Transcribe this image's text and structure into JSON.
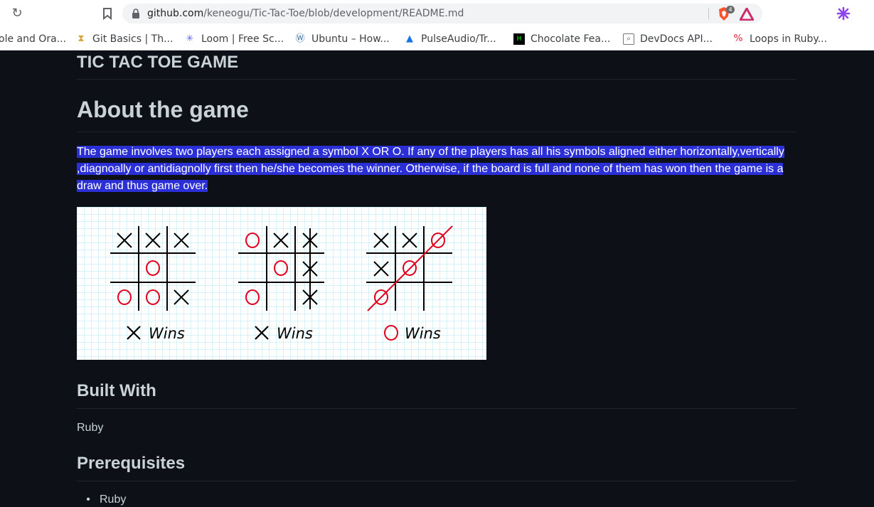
{
  "browser": {
    "url_host": "github.com",
    "url_path": "/keneogu/Tic-Tac-Toe/blob/development/README.md",
    "brave_badge": "4",
    "bookmarks": [
      {
        "label": "ole and Ora...",
        "icon": "oracle-icon"
      },
      {
        "label": "Git Basics | Th...",
        "icon": "hourglass-icon"
      },
      {
        "label": "Loom | Free Sc...",
        "icon": "loom-icon"
      },
      {
        "label": "Ubuntu – How...",
        "icon": "wordpress-icon"
      },
      {
        "label": "PulseAudio/Tr...",
        "icon": "pulseaudio-icon"
      },
      {
        "label": "Chocolate Fea...",
        "icon": "hackernoon-icon"
      },
      {
        "label": "DevDocs API...",
        "icon": "devdocs-icon"
      },
      {
        "label": "Loops in Ruby...",
        "icon": "stripes-icon"
      }
    ]
  },
  "readme": {
    "title": "TIC TAC TOE GAME",
    "about_heading": "About the game",
    "about_text": "The game involves two players each assigned a symbol X OR O. If any of the players has all his symbols aligned either horizontally,vertically ,diagnoally or antidiagnolly first then he/she becomes the winner. Otherwise, if the board is full and none of them has won then the game is a draw and thus game over.",
    "image_captions": [
      "Wins",
      "Wins",
      "Wins"
    ],
    "built_with_heading": "Built With",
    "built_with_text": "Ruby",
    "prereq_heading": "Prerequisites",
    "prereq_items": [
      "Ruby"
    ]
  },
  "colors": {
    "page_bg": "#0d1117",
    "text": "#c9d1d9",
    "selection": "#2b30d6",
    "o_mark": "#e0001b",
    "grid": "#bfe9f7"
  }
}
